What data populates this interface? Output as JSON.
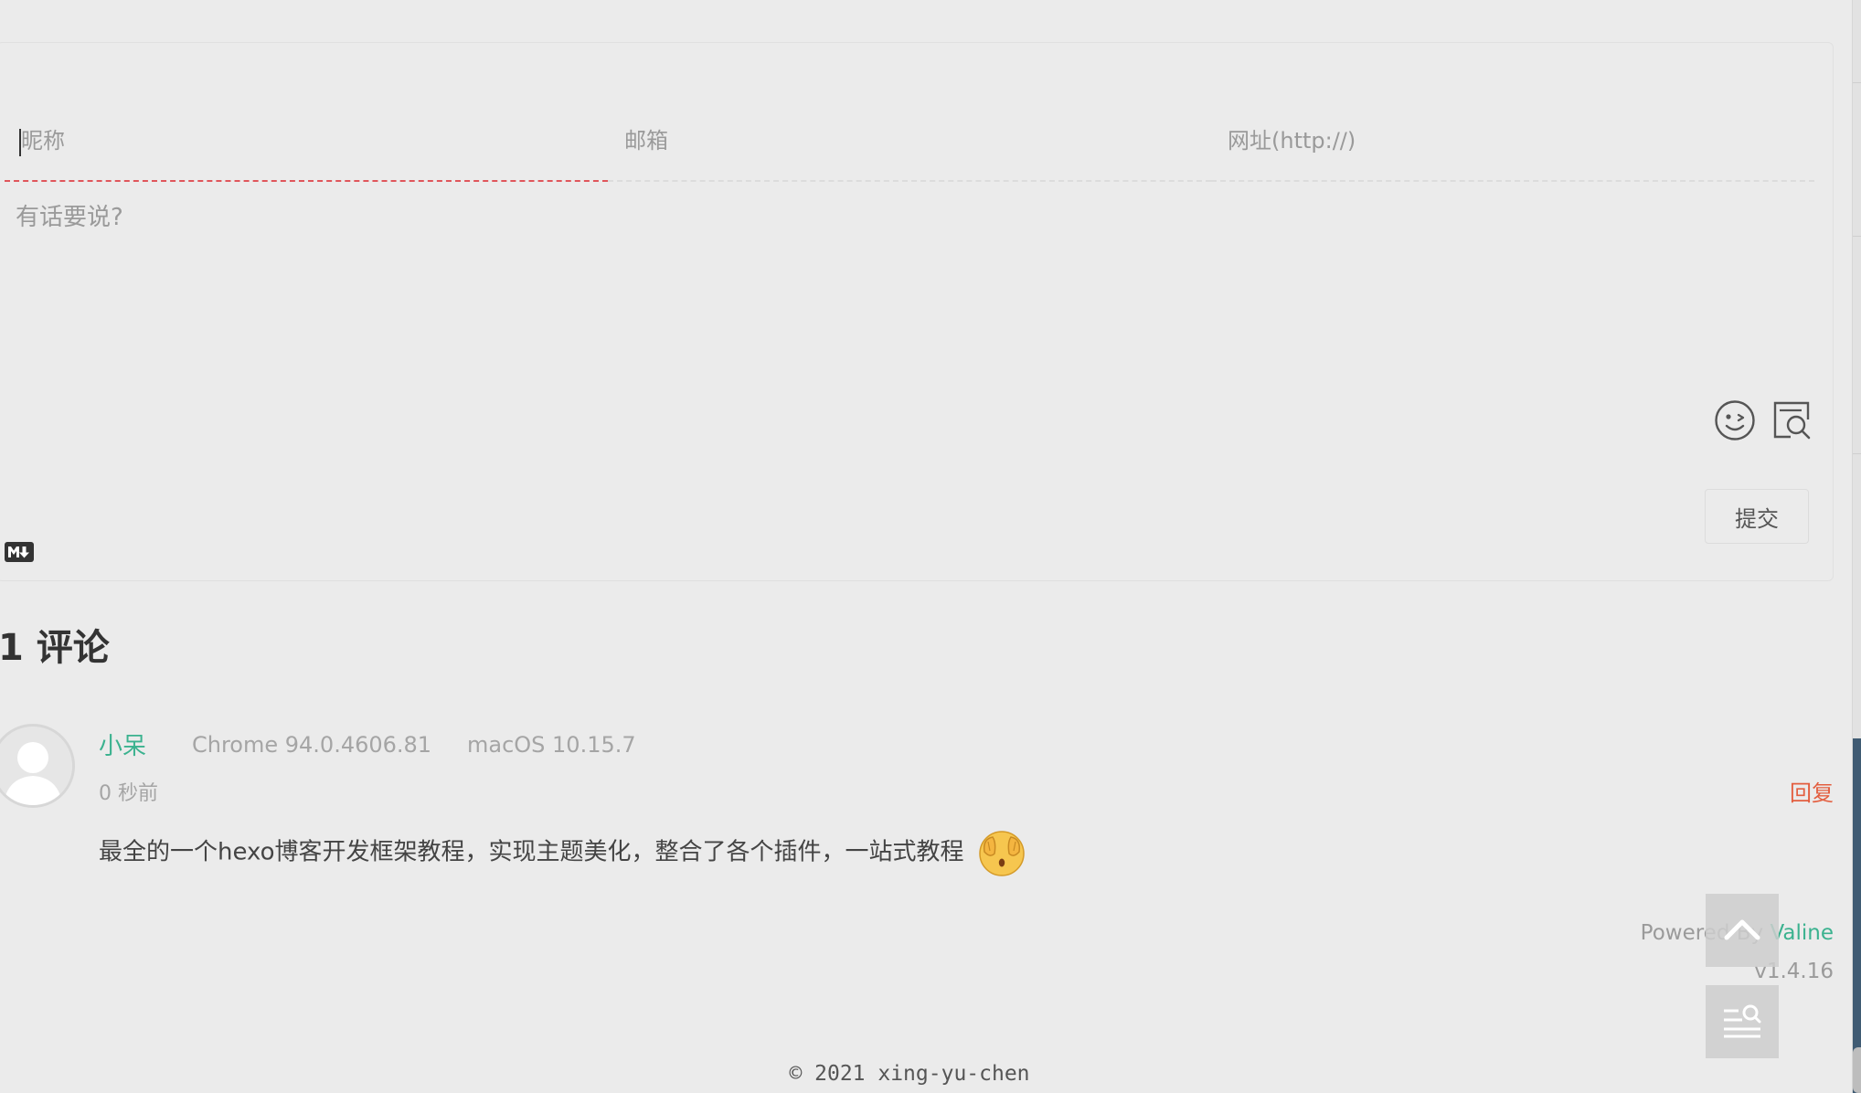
{
  "form": {
    "nick_placeholder": "昵称",
    "mail_placeholder": "邮箱",
    "link_placeholder": "网址(http://)",
    "content_placeholder": "有话要说?",
    "submit_label": "提交",
    "markdown_icon": "markdown-icon",
    "emoji_icon": "emoji-icon",
    "preview_icon": "preview-icon"
  },
  "comments": {
    "count_label": "1 评论",
    "items": [
      {
        "nick": "小呆",
        "browser": "Chrome 94.0.4606.81",
        "os": "macOS 10.15.7",
        "time": "0 秒前",
        "reply_label": "回复",
        "content": "最全的一个hexo博客开发框架教程，实现主题美化，整合了各个插件，一站式教程",
        "emoji": "shy-emoji"
      }
    ]
  },
  "powered": {
    "prefix": "Powered By ",
    "name": "Valine",
    "version": "v1.4.16"
  },
  "footer": {
    "copyright": "© 2021 xing-yu-chen"
  },
  "colors": {
    "accent": "#3bb28f",
    "reply": "#e35e3f",
    "active_underline": "#e0565b",
    "background": "#ebebeb"
  }
}
